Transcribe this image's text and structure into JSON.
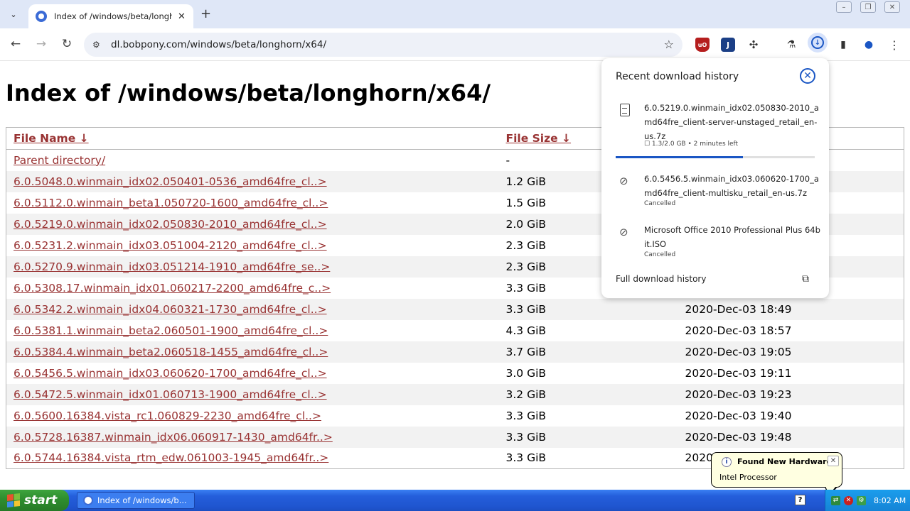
{
  "browser": {
    "tab_title": "Index of /windows/beta/longhorn",
    "url": "dl.bobpony.com/windows/beta/longhorn/x64/",
    "accent": "#1a56c4"
  },
  "page": {
    "title": "Index of /windows/beta/longhorn/x64/",
    "headers": {
      "name": "File Name  ↓",
      "size": "File Size  ↓"
    },
    "rows": [
      {
        "name": "Parent directory/",
        "size": "-",
        "date": ""
      },
      {
        "name": "6.0.5048.0.winmain_idx02.050401-0536_amd64fre_cl..>",
        "size": "1.2 GiB",
        "date": ""
      },
      {
        "name": "6.0.5112.0.winmain_beta1.050720-1600_amd64fre_cl..>",
        "size": "1.5 GiB",
        "date": ""
      },
      {
        "name": "6.0.5219.0.winmain_idx02.050830-2010_amd64fre_cl..>",
        "size": "2.0 GiB",
        "date": ""
      },
      {
        "name": "6.0.5231.2.winmain_idx03.051004-2120_amd64fre_cl..>",
        "size": "2.3 GiB",
        "date": ""
      },
      {
        "name": "6.0.5270.9.winmain_idx03.051214-1910_amd64fre_se..>",
        "size": "2.3 GiB",
        "date": ""
      },
      {
        "name": "6.0.5308.17.winmain_idx01.060217-2200_amd64fre_c..>",
        "size": "3.3 GiB",
        "date": ""
      },
      {
        "name": "6.0.5342.2.winmain_idx04.060321-1730_amd64fre_cl..>",
        "size": "3.3 GiB",
        "date": "2020-Dec-03 18:49"
      },
      {
        "name": "6.0.5381.1.winmain_beta2.060501-1900_amd64fre_cl..>",
        "size": "4.3 GiB",
        "date": "2020-Dec-03 18:57"
      },
      {
        "name": "6.0.5384.4.winmain_beta2.060518-1455_amd64fre_cl..>",
        "size": "3.7 GiB",
        "date": "2020-Dec-03 19:05"
      },
      {
        "name": "6.0.5456.5.winmain_idx03.060620-1700_amd64fre_cl..>",
        "size": "3.0 GiB",
        "date": "2020-Dec-03 19:11"
      },
      {
        "name": "6.0.5472.5.winmain_idx01.060713-1900_amd64fre_cl..>",
        "size": "3.2 GiB",
        "date": "2020-Dec-03 19:23"
      },
      {
        "name": "6.0.5600.16384.vista_rc1.060829-2230_amd64fre_cl..>",
        "size": "3.3 GiB",
        "date": "2020-Dec-03 19:40"
      },
      {
        "name": "6.0.5728.16387.winmain_idx06.060917-1430_amd64fr..>",
        "size": "3.3 GiB",
        "date": "2020-Dec-03 19:48"
      },
      {
        "name": "6.0.5744.16384.vista_rtm_edw.061003-1945_amd64fr..>",
        "size": "3.3 GiB",
        "date": "2020"
      }
    ]
  },
  "downloads": {
    "title": "Recent download history",
    "items": [
      {
        "name": "6.0.5219.0.winmain_idx02.050830-2010_amd64fre_client-server-unstaged_retail_en-us.7z",
        "status": "☐ 1.3/2.0 GB • 2 minutes left",
        "progress": 0.64,
        "icon": "file-icon"
      },
      {
        "name": "6.0.5456.5.winmain_idx03.060620-1700_amd64fre_client-multisku_retail_en-us.7z",
        "status": "Cancelled",
        "icon": "cancelled-icon"
      },
      {
        "name": "Microsoft Office 2010 Professional Plus 64bit.ISO",
        "status": "Cancelled",
        "icon": "cancelled-icon"
      }
    ],
    "full_history": "Full download history"
  },
  "balloon": {
    "title": "Found New Hardware",
    "text": "Intel Processor"
  },
  "taskbar": {
    "start": "start",
    "task": "Index of /windows/b...",
    "clock": "8:02 AM"
  }
}
